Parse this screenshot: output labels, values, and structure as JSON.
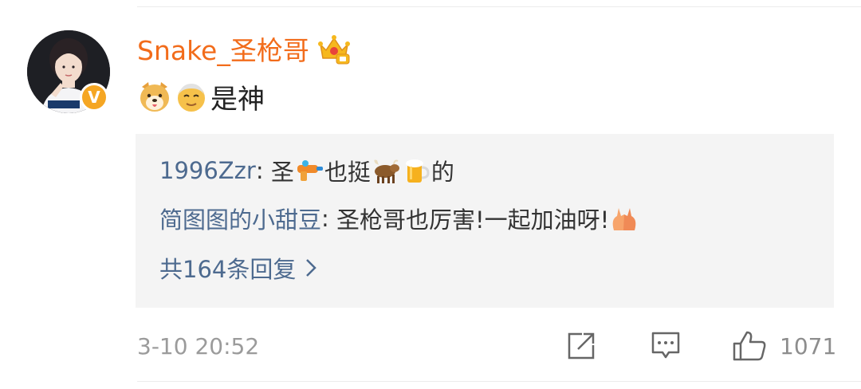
{
  "comment": {
    "username": "Snake_圣枪哥",
    "text": "是神",
    "timestamp": "3-10 20:52",
    "like_count": "1071"
  },
  "replies": [
    {
      "user": "1996Zzr",
      "sep": ": ",
      "parts": [
        "圣",
        "也挺",
        "的"
      ]
    },
    {
      "user": "简图图的小甜豆",
      "sep": ": ",
      "text": "圣枪哥也厉害!一起加油呀!"
    }
  ],
  "more_replies": "共164条回复",
  "icons": {
    "crown": "crown-icon",
    "verified": "verified-badge-icon",
    "share": "share-icon",
    "comment": "comment-icon",
    "like": "thumbs-up-icon"
  },
  "colors": {
    "username": "#f26c1b",
    "reply_user": "#4d6a8f",
    "muted": "#9b9b9b",
    "verified": "#f5a623"
  }
}
